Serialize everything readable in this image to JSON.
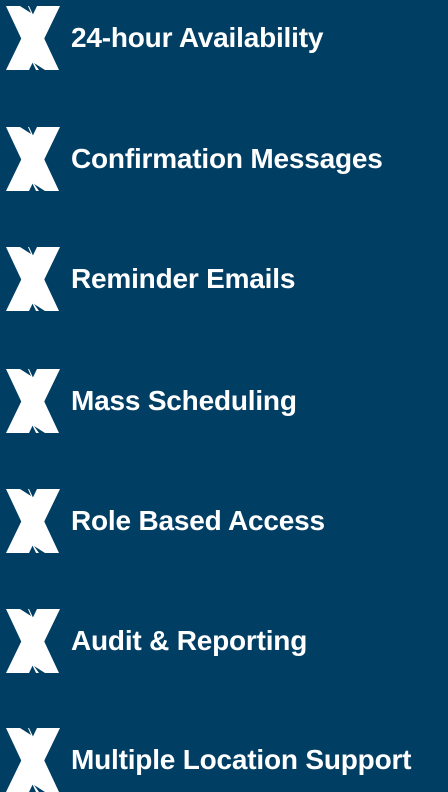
{
  "features": [
    {
      "label": "24-hour Availability",
      "icon": "x-logo-icon"
    },
    {
      "label": "Confirmation Messages",
      "icon": "x-logo-icon"
    },
    {
      "label": "Reminder Emails",
      "icon": "x-logo-icon"
    },
    {
      "label": "Mass Scheduling",
      "icon": "x-logo-icon"
    },
    {
      "label": "Role Based Access",
      "icon": "x-logo-icon"
    },
    {
      "label": "Audit & Reporting",
      "icon": "x-logo-icon"
    },
    {
      "label": "Multiple Location Support",
      "icon": "x-logo-icon"
    }
  ],
  "colors": {
    "background": "#003e64",
    "text": "#ffffff",
    "icon": "#ffffff"
  }
}
